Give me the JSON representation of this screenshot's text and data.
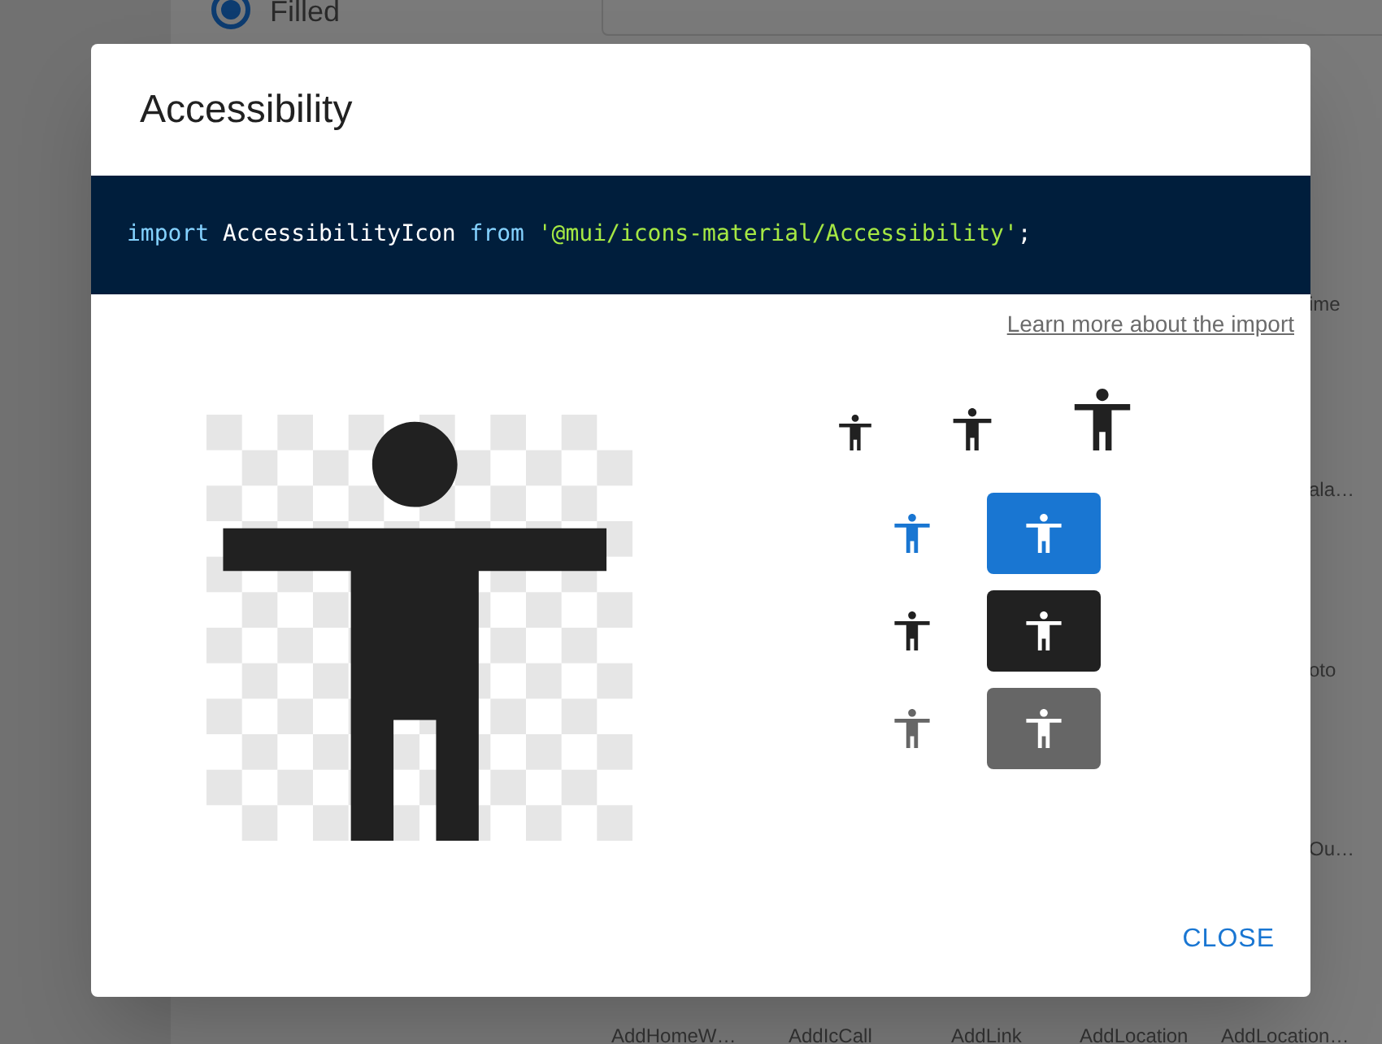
{
  "background": {
    "radio": {
      "label": "Filled",
      "selected": true
    },
    "side_labels": [
      {
        "text": "ime"
      },
      {
        "text": "ala…"
      },
      {
        "text": "oto"
      },
      {
        "text": "Ou…"
      }
    ],
    "bottom_labels": [
      "AddHomeW…",
      "AddIcCall",
      "AddLink",
      "AddLocation",
      "AddLocation…"
    ]
  },
  "dialog": {
    "title": "Accessibility",
    "code": [
      {
        "kind": "keyword",
        "text": "import"
      },
      {
        "kind": "plain",
        "text": " AccessibilityIcon "
      },
      {
        "kind": "keyword",
        "text": "from"
      },
      {
        "kind": "string",
        "text": " '@mui/icons-material/Accessibility'"
      },
      {
        "kind": "plain",
        "text": ";"
      }
    ],
    "link": "Learn more about the import",
    "color_previews": [
      {
        "color": "#1976d2"
      },
      {
        "color": "#212121"
      },
      {
        "color": "#666666"
      }
    ],
    "close": "CLOSE"
  }
}
